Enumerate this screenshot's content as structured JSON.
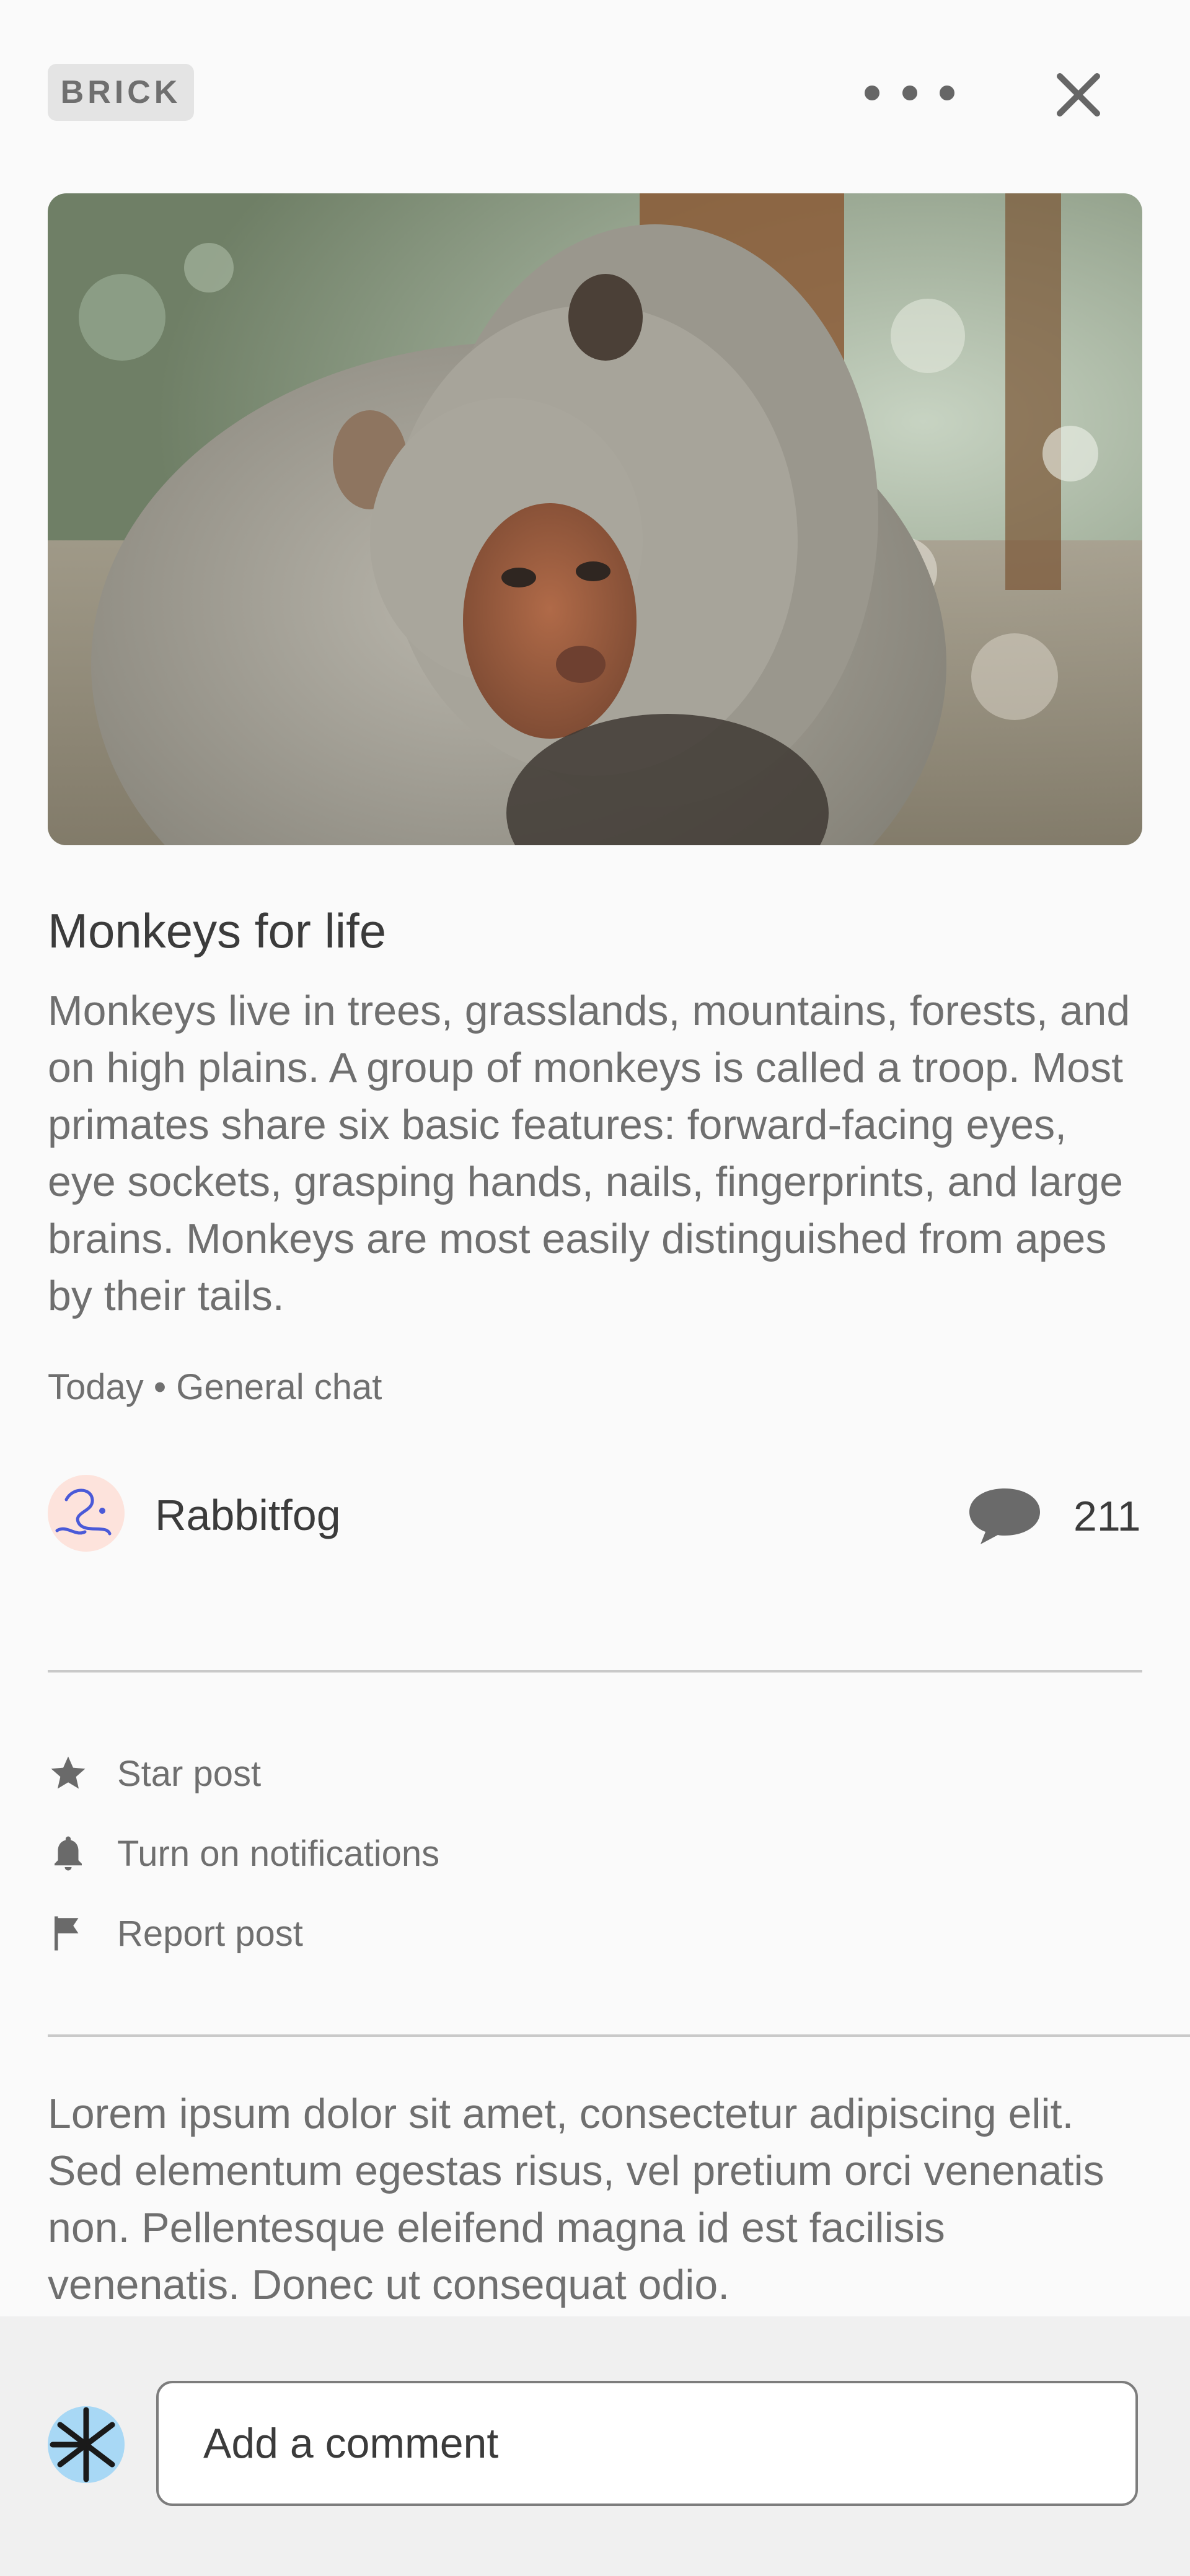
{
  "header": {
    "brand_label": "BRICK",
    "more_icon": "more-horizontal-icon",
    "close_icon": "close-icon"
  },
  "post": {
    "image_description": "hero-image",
    "title": "Monkeys for life",
    "body": "Monkeys live in trees, grasslands, mountains, forests, and on high plains. A group of monkeys is called a troop. Most primates share six basic features: forward-facing eyes, eye sockets, grasping hands, nails, fingerprints, and large brains. Monkeys are most easily distinguished from apes by their tails.",
    "meta": "Today • General chat",
    "author": "Rabbitfog",
    "comment_count": "211"
  },
  "actions": [
    {
      "label": "Star post",
      "icon": "star-icon"
    },
    {
      "label": "Turn on notifications",
      "icon": "bell-icon"
    },
    {
      "label": "Report post",
      "icon": "flag-icon"
    }
  ],
  "comment_preview": "Lorem ipsum dolor sit amet, consectetur adipiscing elit. Sed elementum egestas risus, vel pretium orci venenatis non. Pellentesque eleifend magna id est facilisis venenatis. Donec ut consequat odio.",
  "composer": {
    "placeholder": "Add a comment"
  },
  "colors": {
    "background": "#fafafa",
    "text_primary": "#3b3b3b",
    "text_secondary": "#6f6f6f",
    "bottom_bar": "#f0f0f0",
    "author_avatar_bg": "#fde3dc",
    "user_avatar_bg": "#a8d8f5"
  }
}
